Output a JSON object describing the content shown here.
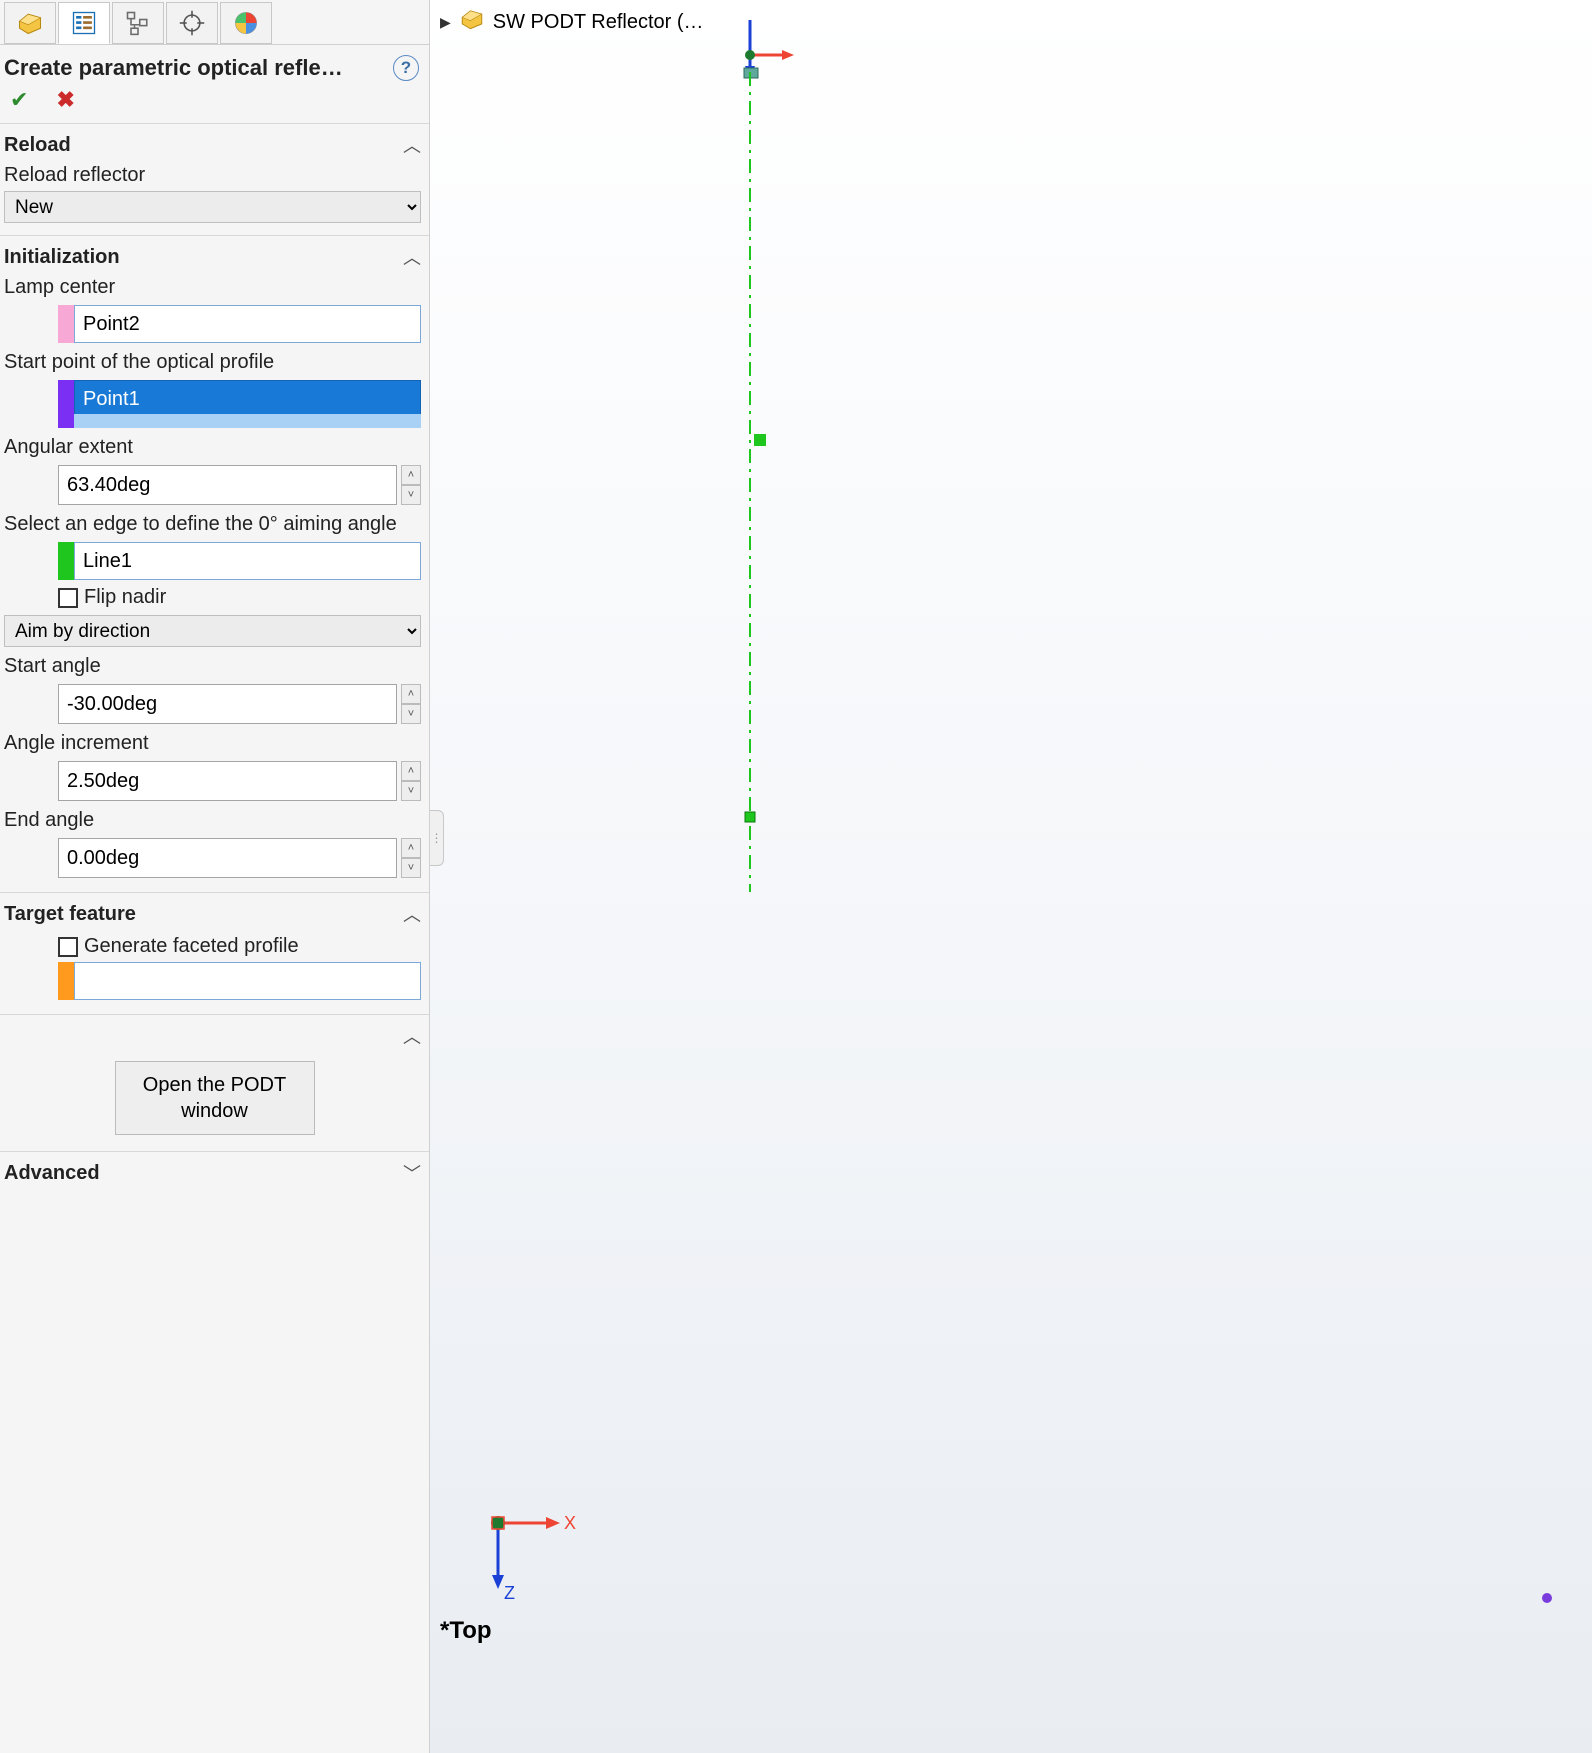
{
  "panel": {
    "title": "Create parametric optical refle…",
    "reload": {
      "header": "Reload",
      "label": "Reload reflector",
      "selected": "New"
    },
    "init": {
      "header": "Initialization",
      "lamp_center_label": "Lamp center",
      "lamp_center_value": "Point2",
      "start_point_label": "Start point of the optical profile",
      "start_point_value": "Point1",
      "angular_extent_label": "Angular extent",
      "angular_extent_value": "63.40deg",
      "edge_label": "Select an edge to define the 0° aiming angle",
      "edge_value": "Line1",
      "flip_nadir_label": "Flip nadir",
      "aim_by_selected": "Aim by direction",
      "start_angle_label": "Start angle",
      "start_angle_value": "-30.00deg",
      "angle_incr_label": "Angle increment",
      "angle_incr_value": "2.50deg",
      "end_angle_label": "End angle",
      "end_angle_value": "0.00deg"
    },
    "target": {
      "header": "Target feature",
      "gen_faceted_label": "Generate faceted profile",
      "value": ""
    },
    "podt_button": "Open the PODT window",
    "advanced_header": "Advanced"
  },
  "viewport": {
    "tree_item": "SW PODT Reflector  (…",
    "view_label": "*Top",
    "axis_x": "X",
    "axis_z": "Z"
  }
}
